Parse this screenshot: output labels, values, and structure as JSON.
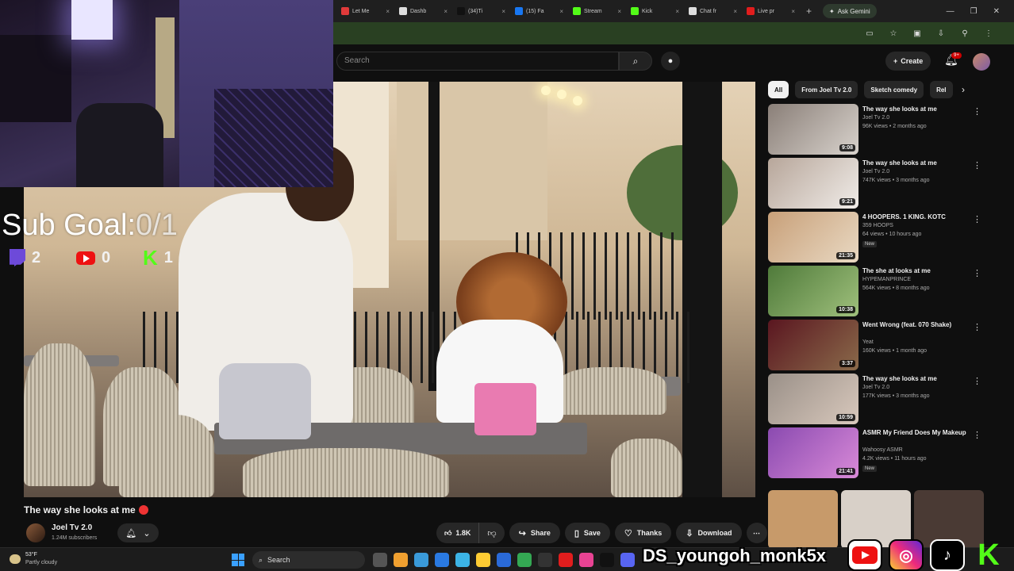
{
  "browser": {
    "tabs": [
      {
        "label": "Let Me",
        "color": "#e03a3a"
      },
      {
        "label": "Dashb",
        "color": "#dddddd"
      },
      {
        "label": "(34)Ti",
        "color": "#111111"
      },
      {
        "label": "(15) Fa",
        "color": "#1877f2"
      },
      {
        "label": "Stream",
        "color": "#53fc18"
      },
      {
        "label": "Kick",
        "color": "#53fc18"
      },
      {
        "label": "Chat fr",
        "color": "#dddddd"
      },
      {
        "label": "Live pr",
        "color": "#e11d1d"
      }
    ],
    "gemini_label": "Ask Gemini"
  },
  "youtube": {
    "search_placeholder": "Search",
    "create_label": "Create",
    "notif_count": "9+"
  },
  "overlay": {
    "sub_goal_label": "Sub Goal:",
    "sub_goal_value": "0/1",
    "counts": {
      "twitch": "2",
      "youtube": "0",
      "kick": "1"
    },
    "handle": "DS_youngoh_monk5x"
  },
  "video": {
    "title": "The way she looks at me",
    "channel": "Joel Tv 2.0",
    "subscribers": "1.24M subscribers",
    "likes": "1.8K",
    "actions": {
      "share": "Share",
      "save": "Save",
      "thanks": "Thanks",
      "download": "Download"
    }
  },
  "sidebar": {
    "chips": [
      {
        "label": "All",
        "active": true
      },
      {
        "label": "From Joel Tv 2.0",
        "active": false
      },
      {
        "label": "Sketch comedy",
        "active": false
      },
      {
        "label": "Rel",
        "active": false
      }
    ],
    "recommendations": [
      {
        "title": "The way she looks at me",
        "channel": "Joel Tv 2.0",
        "meta": "96K views • 2 months ago",
        "duration": "9:08",
        "badge": "",
        "colors": [
          "#8a7f78",
          "#d8d2cc"
        ]
      },
      {
        "title": "The way she looks at me",
        "channel": "Joel Tv 2.0",
        "meta": "747K views • 3 months ago",
        "duration": "9:21",
        "badge": "",
        "colors": [
          "#b7a69a",
          "#f0ece8"
        ]
      },
      {
        "title": "4 HOOPERS. 1 KING. KOTC",
        "channel": "359 HOOPS",
        "meta": "64 views • 10 hours ago",
        "duration": "21:35",
        "badge": "New",
        "colors": [
          "#c8a079",
          "#e9d9c3"
        ]
      },
      {
        "title": "The she at looks at me",
        "channel": "HYPEMANPRINCE",
        "meta": "564K views • 8 months ago",
        "duration": "10:38",
        "badge": "",
        "colors": [
          "#4f7a3a",
          "#9fc07c"
        ]
      },
      {
        "title": "Went Wrong (feat. 070 Shake)",
        "channel": "Yeat",
        "meta": "160K views • 1 month ago",
        "duration": "3:37",
        "badge": "",
        "colors": [
          "#5a1620",
          "#8a6a4a"
        ]
      },
      {
        "title": "The way she looks at me",
        "channel": "Joel Tv 2.0",
        "meta": "177K views • 3 months ago",
        "duration": "10:59",
        "badge": "",
        "colors": [
          "#9a9088",
          "#d8c8bc"
        ]
      },
      {
        "title": "ASMR My Friend Does My Makeup",
        "channel": "Wahoosy ASMR",
        "meta": "4.2K views • 11 hours ago",
        "duration": "21:41",
        "badge": "New",
        "colors": [
          "#8a4ab0",
          "#d98ad8"
        ]
      }
    ],
    "shorts_colors": [
      "#c79a6a",
      "#d8d0c8",
      "#4a3a34"
    ]
  },
  "taskbar": {
    "temp": "53°F",
    "weather": "Partly cloudy",
    "search_label": "Search",
    "app_colors": [
      "#555555",
      "#f0a030",
      "#3a9ad9",
      "#2a7ae2",
      "#3cb4e6",
      "#ffcc33",
      "#2a6ad8",
      "#34a853",
      "#333333",
      "#e11d1d",
      "#e84393",
      "#111111",
      "#5865f2"
    ]
  }
}
